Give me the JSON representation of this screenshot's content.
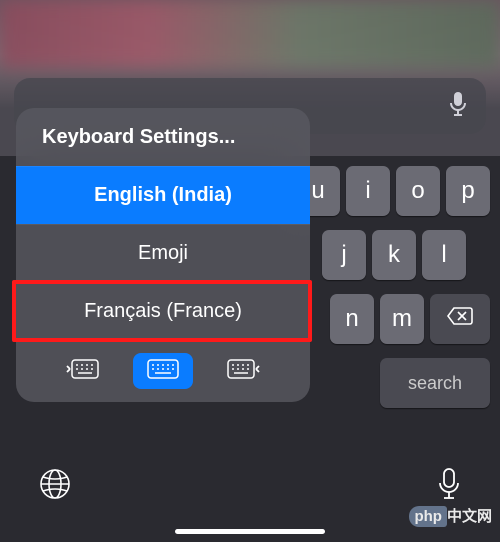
{
  "search": {
    "placeholder": ""
  },
  "popup": {
    "settings": "Keyboard Settings...",
    "languages": [
      "English (India)",
      "Emoji",
      "Français (France)"
    ],
    "selected_index": 0,
    "highlighted_index": 2
  },
  "keyboard": {
    "row1": [
      "u",
      "i",
      "o",
      "p"
    ],
    "row2": [
      "j",
      "k",
      "l"
    ],
    "row3": [
      "n",
      "m"
    ],
    "search_label": "search"
  },
  "watermark": {
    "left": "php",
    "right": "中文网"
  }
}
